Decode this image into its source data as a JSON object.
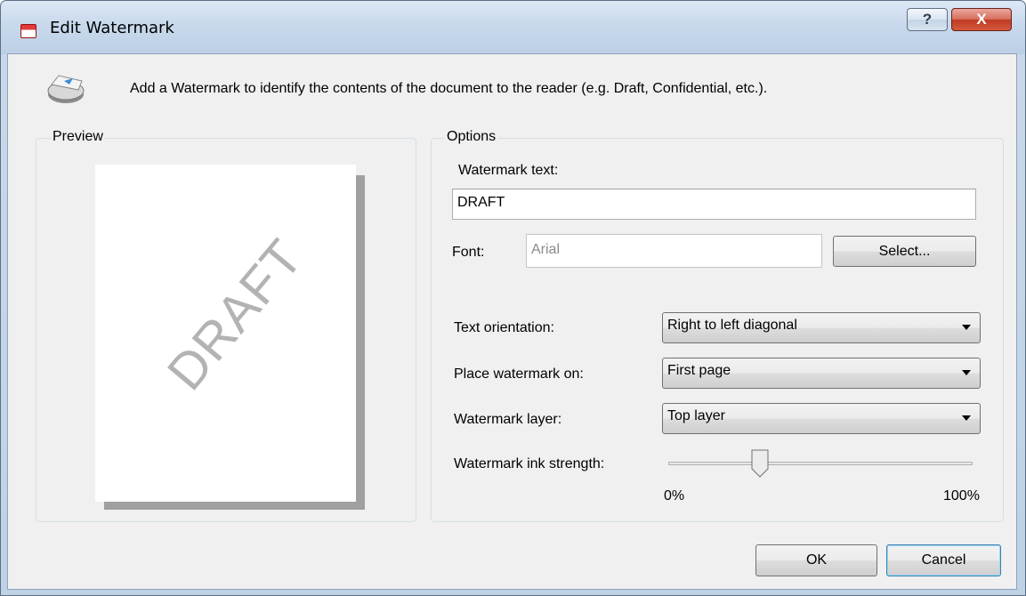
{
  "window": {
    "title": "Edit Watermark",
    "help_label": "?",
    "close_label": "X"
  },
  "description": "Add a Watermark to identify the contents of the document to the reader (e.g. Draft, Confidential, etc.).",
  "preview": {
    "group_label": "Preview",
    "watermark_sample": "DRAFT"
  },
  "options": {
    "group_label": "Options",
    "watermark_text_label": "Watermark text:",
    "watermark_text_value": "DRAFT",
    "font_label": "Font:",
    "font_value": "Arial",
    "select_button": "Select...",
    "text_orientation_label": "Text orientation:",
    "text_orientation_value": "Right to left diagonal",
    "place_on_label": "Place watermark on:",
    "place_on_value": "First page",
    "layer_label": "Watermark layer:",
    "layer_value": "Top layer",
    "ink_strength_label": "Watermark ink strength:",
    "ink_min": "0%",
    "ink_max": "100%",
    "ink_strength_fraction": 0.3
  },
  "footer": {
    "ok_label": "OK",
    "cancel_label": "Cancel"
  }
}
